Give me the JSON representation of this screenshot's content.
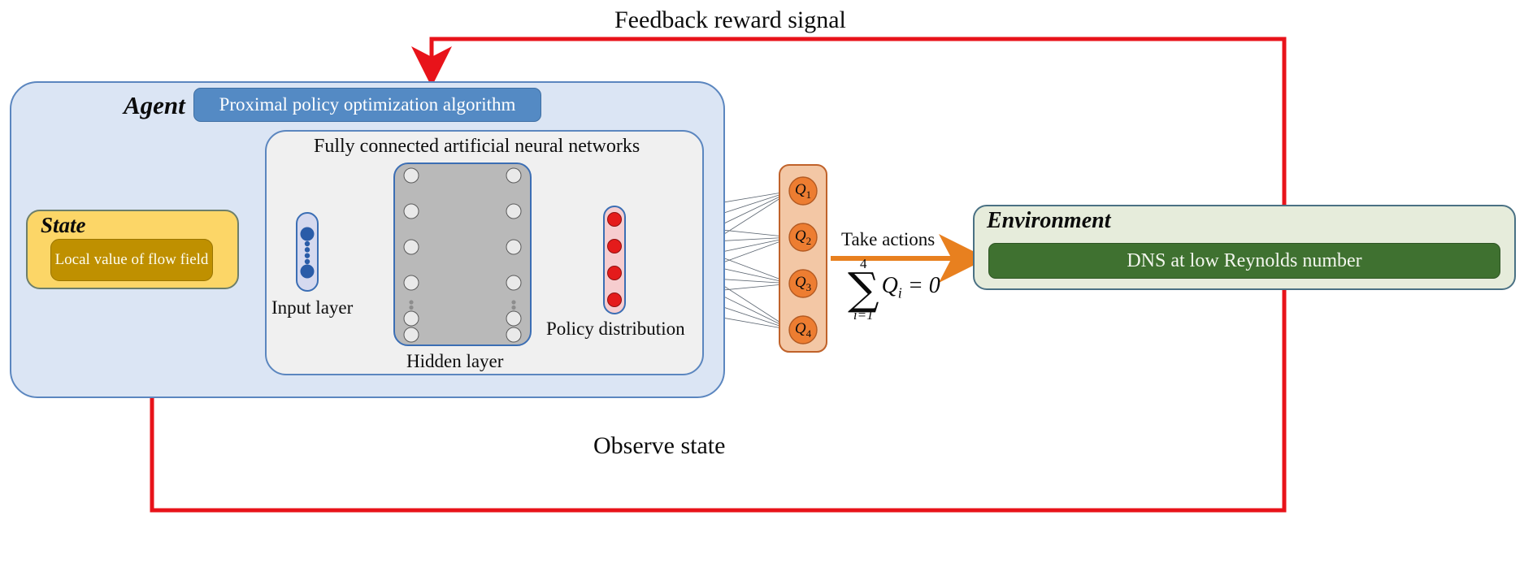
{
  "diagram": {
    "title_top": "Feedback reward signal",
    "title_bottom": "Observe state"
  },
  "agent": {
    "title": "Agent",
    "algorithm_label": "Proximal policy optimization algorithm"
  },
  "state": {
    "title": "State",
    "inner_label": "Local value of flow field"
  },
  "network": {
    "title": "Fully connected artificial neural networks",
    "input_layer_label": "Input layer",
    "hidden_layer_label": "Hidden layer",
    "policy_layer_label": "Policy distribution"
  },
  "actions": {
    "take_actions_label": "Take actions",
    "sum_upper": "4",
    "sum_lower": "i=1",
    "sum_symbol": "∑",
    "sum_body_Q": "Q",
    "sum_body_index": "i",
    "sum_body_rest": " = 0",
    "q_nodes": [
      {
        "label": "Q",
        "index": "1"
      },
      {
        "label": "Q",
        "index": "2"
      },
      {
        "label": "Q",
        "index": "3"
      },
      {
        "label": "Q",
        "index": "4"
      }
    ]
  },
  "environment": {
    "title": "Environment",
    "inner_label": "DNS at low Reynolds number"
  },
  "colors": {
    "agent_fill": "#dbe5f4",
    "agent_stroke": "#5b86bf",
    "ppo_fill": "#548ac4",
    "ann_fill": "#f0f0f0",
    "state_fill": "#fcd667",
    "state_inner_fill": "#bf9000",
    "input_node": "#2a5ca8",
    "hidden_fill": "#b9b9b9",
    "policy_node": "#e41b1b",
    "q_fill": "#ed7d31",
    "q_panel": "#f3c7a5",
    "env_fill": "#e6ecdb",
    "env_inner_fill": "#3f7130",
    "feedback_arrow": "#e8131a",
    "action_arrow": "#e8801f",
    "state_arrow": "#2a4f9c",
    "connection_line": "#555f6b"
  }
}
